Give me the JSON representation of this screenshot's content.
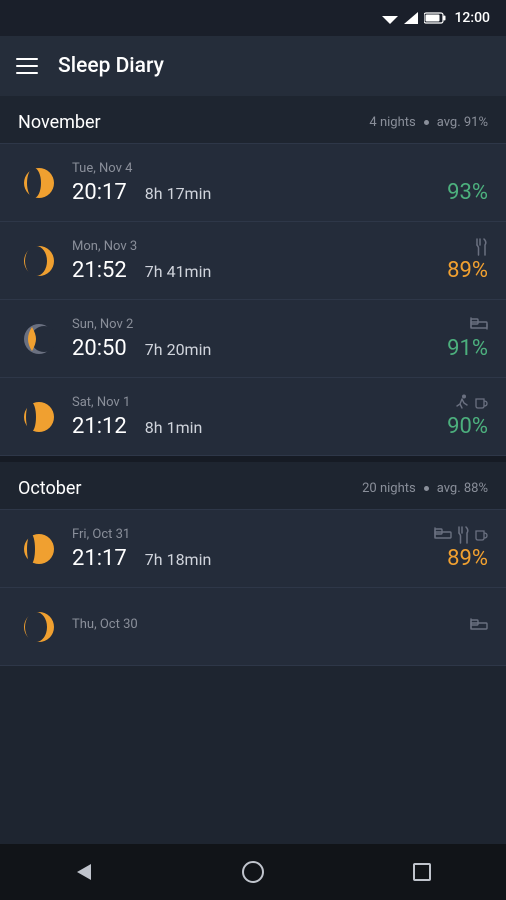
{
  "statusBar": {
    "time": "12:00"
  },
  "header": {
    "title": "Sleep Diary",
    "menuLabel": "Menu"
  },
  "sections": [
    {
      "id": "november",
      "month": "November",
      "nights": "4 nights",
      "avg": "avg. 91%",
      "entries": [
        {
          "id": "nov4",
          "date": "Tue, Nov 4",
          "bedtime": "20:17",
          "duration": "8h 17min",
          "score": "93%",
          "scoreColor": "green",
          "moonPhase": "waxing-gibbous",
          "icons": []
        },
        {
          "id": "nov3",
          "date": "Mon, Nov 3",
          "bedtime": "21:52",
          "duration": "7h 41min",
          "score": "89%",
          "scoreColor": "orange",
          "moonPhase": "waxing-crescent",
          "icons": [
            "fork-knife"
          ]
        },
        {
          "id": "nov2",
          "date": "Sun, Nov 2",
          "bedtime": "20:50",
          "duration": "7h 20min",
          "score": "91%",
          "scoreColor": "green",
          "moonPhase": "crescent",
          "icons": [
            "bed"
          ]
        },
        {
          "id": "nov1",
          "date": "Sat, Nov 1",
          "bedtime": "21:12",
          "duration": "8h 1min",
          "score": "90%",
          "scoreColor": "green",
          "moonPhase": "full",
          "icons": [
            "run",
            "coffee"
          ]
        }
      ]
    },
    {
      "id": "october",
      "month": "October",
      "nights": "20 nights",
      "avg": "avg. 88%",
      "entries": [
        {
          "id": "oct31",
          "date": "Fri, Oct 31",
          "bedtime": "21:17",
          "duration": "7h 18min",
          "score": "89%",
          "scoreColor": "orange",
          "moonPhase": "full",
          "icons": [
            "bed",
            "fork-knife",
            "coffee"
          ]
        },
        {
          "id": "oct30",
          "date": "Thu, Oct 30",
          "bedtime": "",
          "duration": "",
          "score": "",
          "scoreColor": "green",
          "moonPhase": "waxing-crescent",
          "icons": [
            "bed"
          ]
        }
      ]
    }
  ],
  "bottomNav": {
    "backLabel": "Back",
    "homeLabel": "Home",
    "recentLabel": "Recent"
  }
}
